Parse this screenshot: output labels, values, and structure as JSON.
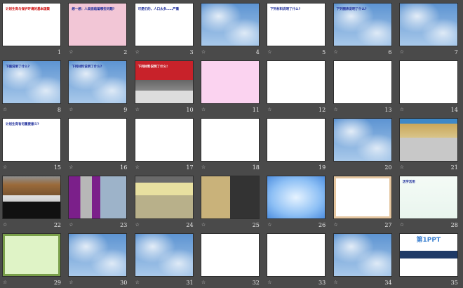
{
  "view": "slide-sorter",
  "slides": [
    {
      "number": "1",
      "caption": "计划生育与保护环境的基本国策",
      "theme": "white",
      "transition_icon": false
    },
    {
      "number": "2",
      "caption": "想一想：人类面临着哪些问题?",
      "theme": "pink",
      "transition_icon": true
    },
    {
      "number": "3",
      "caption": "可是们的，人口太多……严重",
      "theme": "white",
      "transition_icon": true
    },
    {
      "number": "4",
      "caption": "",
      "theme": "sky",
      "transition_icon": true
    },
    {
      "number": "5",
      "caption": "下列材料说明了什么?",
      "theme": "white",
      "transition_icon": true
    },
    {
      "number": "6",
      "caption": "下列图表说明了什么?",
      "theme": "sky",
      "transition_icon": true
    },
    {
      "number": "7",
      "caption": "",
      "theme": "sky",
      "transition_icon": true
    },
    {
      "number": "8",
      "caption": "下图说明了什么?",
      "theme": "sky",
      "transition_icon": true
    },
    {
      "number": "9",
      "caption": "下列材料说明了什么?",
      "theme": "sky",
      "transition_icon": true
    },
    {
      "number": "10",
      "caption": "下列材料说明了什么!",
      "theme": "photo",
      "transition_icon": true
    },
    {
      "number": "11",
      "caption": "",
      "theme": "lpink",
      "transition_icon": true
    },
    {
      "number": "12",
      "caption": "",
      "theme": "white",
      "transition_icon": true
    },
    {
      "number": "13",
      "caption": "",
      "theme": "white",
      "transition_icon": true
    },
    {
      "number": "14",
      "caption": "",
      "theme": "white",
      "transition_icon": true
    },
    {
      "number": "15",
      "caption": "计划生育有何重要意义?",
      "theme": "white",
      "transition_icon": true
    },
    {
      "number": "16",
      "caption": "",
      "theme": "white",
      "transition_icon": true
    },
    {
      "number": "17",
      "caption": "",
      "theme": "white",
      "transition_icon": true
    },
    {
      "number": "18",
      "caption": "",
      "theme": "white",
      "transition_icon": true
    },
    {
      "number": "19",
      "caption": "",
      "theme": "white",
      "transition_icon": false
    },
    {
      "number": "20",
      "caption": "",
      "theme": "sky",
      "transition_icon": false
    },
    {
      "number": "21",
      "caption": "",
      "theme": "land",
      "transition_icon": true
    },
    {
      "number": "22",
      "caption": "",
      "theme": "factory",
      "transition_icon": true
    },
    {
      "number": "23",
      "caption": "",
      "theme": "purple",
      "transition_icon": true
    },
    {
      "number": "24",
      "caption": "",
      "theme": "street",
      "transition_icon": true
    },
    {
      "number": "25",
      "caption": "",
      "theme": "collage",
      "transition_icon": true
    },
    {
      "number": "26",
      "caption": "",
      "theme": "blue",
      "transition_icon": true
    },
    {
      "number": "27",
      "caption": "",
      "theme": "frame",
      "transition_icon": true
    },
    {
      "number": "28",
      "caption": "活学活用",
      "theme": "pale",
      "transition_icon": true
    },
    {
      "number": "29",
      "caption": "",
      "theme": "green",
      "transition_icon": true
    },
    {
      "number": "30",
      "caption": "",
      "theme": "sky",
      "transition_icon": true
    },
    {
      "number": "31",
      "caption": "",
      "theme": "sky",
      "transition_icon": true
    },
    {
      "number": "32",
      "caption": "",
      "theme": "white",
      "transition_icon": true
    },
    {
      "number": "33",
      "caption": "",
      "theme": "white",
      "transition_icon": true
    },
    {
      "number": "34",
      "caption": "",
      "theme": "sky",
      "transition_icon": true
    },
    {
      "number": "35",
      "caption": "第1PPT",
      "theme": "ppt",
      "transition_icon": false
    }
  ],
  "transition_icon_glyph": "☆"
}
